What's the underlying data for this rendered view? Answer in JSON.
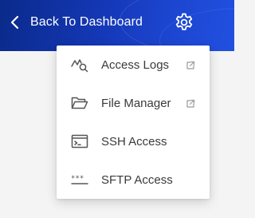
{
  "header": {
    "back_label": "Back To Dashboard",
    "back_icon": "chevron-left-icon",
    "settings_icon": "gear-icon"
  },
  "menu": {
    "items": [
      {
        "label": "Access Logs",
        "icon": "activity-search-icon",
        "external": true
      },
      {
        "label": "File Manager",
        "icon": "folder-open-icon",
        "external": true
      },
      {
        "label": "SSH Access",
        "icon": "terminal-icon",
        "external": false
      },
      {
        "label": "SFTP Access",
        "icon": "password-dots-icon",
        "external": false
      }
    ]
  },
  "colors": {
    "header_start": "#0a2a8a",
    "header_end": "#2150e0",
    "menu_text": "#3a3a3a",
    "icon_gray": "#555555"
  }
}
